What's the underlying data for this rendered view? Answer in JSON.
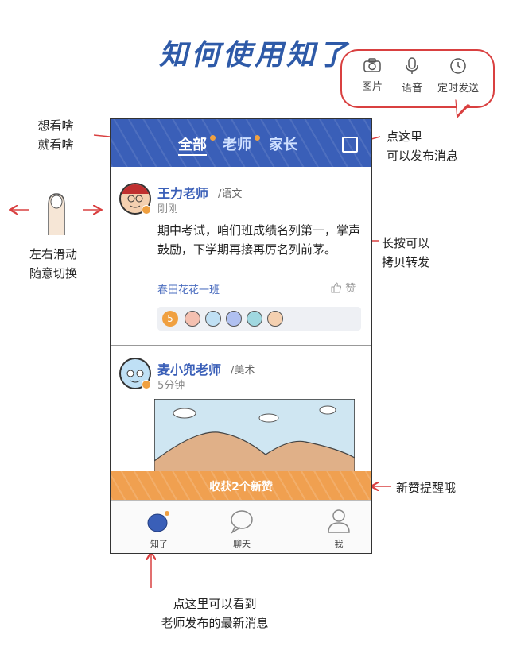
{
  "title": "知何使用知了",
  "toolbar_bubble": {
    "items": [
      {
        "label": "图片",
        "icon": "camera-icon"
      },
      {
        "label": "语音",
        "icon": "microphone-icon"
      },
      {
        "label": "定时发送",
        "icon": "clock-icon"
      }
    ]
  },
  "annotations": {
    "swipe_view": "想看啥\n就看啥",
    "post_here": "点这里\n可以发布消息",
    "swipe_switch": "左右滑动\n随意切换",
    "long_press": "长按可以\n拷贝转发",
    "new_likes": "新赞提醒哦",
    "bottom_note": "点这里可以看到\n老师发布的最新消息"
  },
  "phone": {
    "tabs": [
      "全部",
      "老师",
      "家长"
    ],
    "posts": [
      {
        "author": "王力老师",
        "subject": "/语文",
        "time": "刚刚",
        "text": "期中考试，咱们班成绩名列第一，掌声鼓励，下学期再接再厉名列前茅。",
        "class_tag": "春田花花一班",
        "like_label": "赞",
        "like_count": "5"
      },
      {
        "author": "麦小兜老师",
        "subject": "/美术",
        "time": "5分钟"
      }
    ],
    "banner": "收获2个新赞",
    "tabbar": [
      "知了",
      "聊天",
      "我"
    ]
  },
  "colors": {
    "header_blue": "#3a5fb8",
    "accent_orange": "#f0a050",
    "annotation_red": "#d94040"
  }
}
